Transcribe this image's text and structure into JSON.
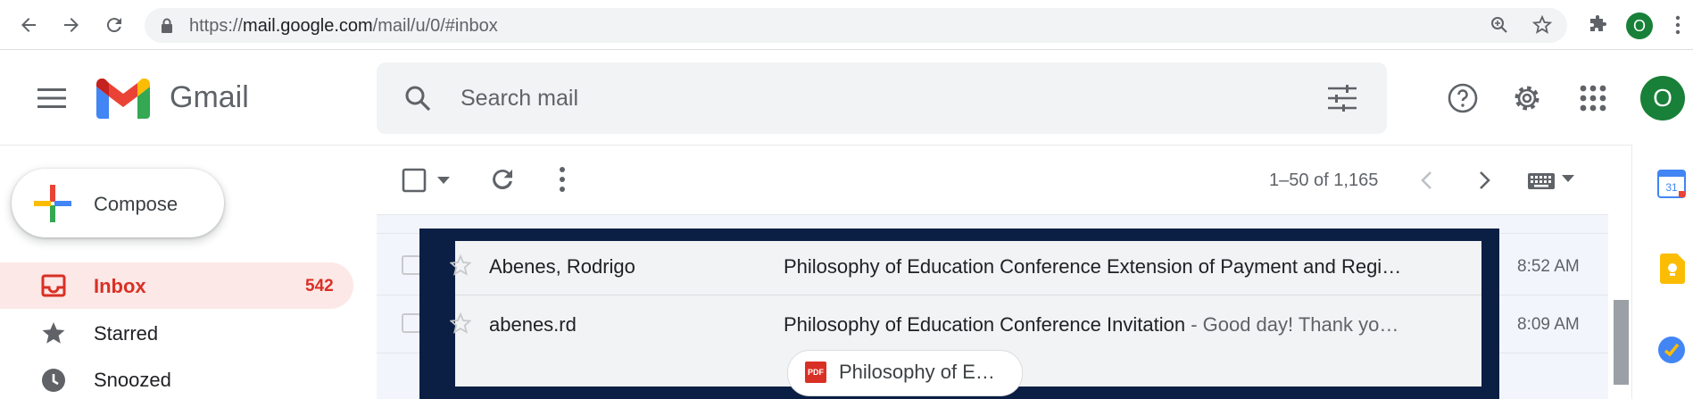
{
  "browser": {
    "url_prefix": "https://",
    "url_main": "mail.google.com",
    "url_rest": "/mail/u/0/#inbox",
    "profile_initial": "O"
  },
  "header": {
    "app_name": "Gmail",
    "search_placeholder": "Search mail",
    "avatar_initial": "O"
  },
  "sidebar": {
    "compose_label": "Compose",
    "items": [
      {
        "label": "Inbox",
        "count": "542",
        "icon": "inbox-icon",
        "active": true
      },
      {
        "label": "Starred",
        "count": "",
        "icon": "star-icon",
        "active": false
      },
      {
        "label": "Snoozed",
        "count": "",
        "icon": "clock-icon",
        "active": false
      }
    ]
  },
  "toolbar": {
    "pagination": "1–50 of 1,165"
  },
  "emails": [
    {
      "sender": "Abenes, Rodrigo",
      "subject": "Philosophy of Education Conference Extension of Payment and Regi…",
      "snippet": "",
      "time": "8:52 AM"
    },
    {
      "sender": "abenes.rd",
      "subject": "Philosophy of Education Conference Invitation",
      "snippet": " - Good day! Thank yo…",
      "time": "8:09 AM",
      "attachment": {
        "type_label": "PDF",
        "name": "Philosophy of E…"
      }
    }
  ],
  "colors": {
    "accent_red": "#d93025",
    "active_bg": "#fce8e6",
    "overlay": "#0b1f45",
    "avatar_green": "#188038"
  }
}
